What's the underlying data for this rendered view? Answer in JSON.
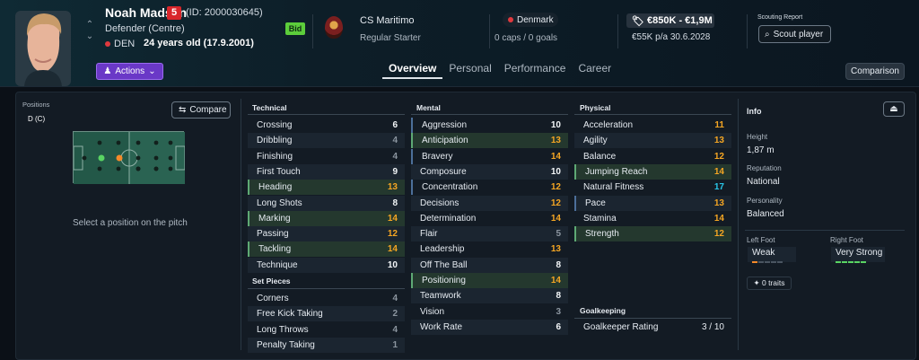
{
  "player": {
    "name": "Noah Madsen",
    "number": "5",
    "id": "(ID: 2000030645)",
    "position": "Defender (Centre)",
    "nationality_code": "DEN",
    "age": "24 years old (17.9.2001)",
    "bid_label": "Bid"
  },
  "club": {
    "name": "CS Maritimo",
    "role": "Regular Starter"
  },
  "country": {
    "name": "Denmark",
    "caps": "0 caps / 0 goals"
  },
  "contract": {
    "value": "€850K - €1,9M",
    "wage": "€55K p/a 30.6.2028"
  },
  "scouting": {
    "label": "Scouting Report",
    "button": "Scout player"
  },
  "actions_label": "Actions",
  "tabs": [
    "Overview",
    "Personal",
    "Performance",
    "Career"
  ],
  "comparison_label": "Comparison",
  "positions": {
    "label": "Positions",
    "value": "D (C)",
    "compare_label": "Compare",
    "hint": "Select a position on the pitch"
  },
  "technical": {
    "title": "Technical",
    "attrs": [
      {
        "name": "Crossing",
        "value": "6",
        "color": "white"
      },
      {
        "name": "Dribbling",
        "value": "4",
        "color": "grey"
      },
      {
        "name": "Finishing",
        "value": "4",
        "color": "grey"
      },
      {
        "name": "First Touch",
        "value": "9",
        "color": "white"
      },
      {
        "name": "Heading",
        "value": "13",
        "color": "orange",
        "hl": true
      },
      {
        "name": "Long Shots",
        "value": "8",
        "color": "white"
      },
      {
        "name": "Marking",
        "value": "14",
        "color": "orange",
        "hl": true
      },
      {
        "name": "Passing",
        "value": "12",
        "color": "orange"
      },
      {
        "name": "Tackling",
        "value": "14",
        "color": "orange",
        "hl": true
      },
      {
        "name": "Technique",
        "value": "10",
        "color": "white"
      }
    ]
  },
  "set_pieces": {
    "title": "Set Pieces",
    "attrs": [
      {
        "name": "Corners",
        "value": "4",
        "color": "grey"
      },
      {
        "name": "Free Kick Taking",
        "value": "2",
        "color": "grey"
      },
      {
        "name": "Long Throws",
        "value": "4",
        "color": "grey"
      },
      {
        "name": "Penalty Taking",
        "value": "1",
        "color": "grey"
      }
    ]
  },
  "mental": {
    "title": "Mental",
    "attrs": [
      {
        "name": "Aggression",
        "value": "10",
        "color": "white",
        "bl": true
      },
      {
        "name": "Anticipation",
        "value": "13",
        "color": "orange",
        "hl": true
      },
      {
        "name": "Bravery",
        "value": "14",
        "color": "orange",
        "bl": true
      },
      {
        "name": "Composure",
        "value": "10",
        "color": "white"
      },
      {
        "name": "Concentration",
        "value": "12",
        "color": "orange",
        "bl": true
      },
      {
        "name": "Decisions",
        "value": "12",
        "color": "orange"
      },
      {
        "name": "Determination",
        "value": "14",
        "color": "orange"
      },
      {
        "name": "Flair",
        "value": "5",
        "color": "grey"
      },
      {
        "name": "Leadership",
        "value": "13",
        "color": "orange"
      },
      {
        "name": "Off The Ball",
        "value": "8",
        "color": "white"
      },
      {
        "name": "Positioning",
        "value": "14",
        "color": "orange",
        "hl": true
      },
      {
        "name": "Teamwork",
        "value": "8",
        "color": "white"
      },
      {
        "name": "Vision",
        "value": "3",
        "color": "grey"
      },
      {
        "name": "Work Rate",
        "value": "6",
        "color": "white"
      }
    ]
  },
  "physical": {
    "title": "Physical",
    "attrs": [
      {
        "name": "Acceleration",
        "value": "11",
        "color": "orange"
      },
      {
        "name": "Agility",
        "value": "13",
        "color": "orange"
      },
      {
        "name": "Balance",
        "value": "12",
        "color": "orange"
      },
      {
        "name": "Jumping Reach",
        "value": "14",
        "color": "orange",
        "hl": true
      },
      {
        "name": "Natural Fitness",
        "value": "17",
        "color": "cyan"
      },
      {
        "name": "Pace",
        "value": "13",
        "color": "orange",
        "bl": true
      },
      {
        "name": "Stamina",
        "value": "14",
        "color": "orange"
      },
      {
        "name": "Strength",
        "value": "12",
        "color": "orange",
        "hl": true
      }
    ]
  },
  "goalkeeping": {
    "title": "Goalkeeping",
    "rating_label": "Goalkeeper Rating",
    "rating_value": "3 / 10"
  },
  "info": {
    "title": "Info",
    "height_label": "Height",
    "height": "1,87 m",
    "reputation_label": "Reputation",
    "reputation": "National",
    "personality_label": "Personality",
    "personality": "Balanced",
    "left_foot_label": "Left Foot",
    "left_foot": "Weak",
    "left_foot_level": 0.2,
    "right_foot_label": "Right Foot",
    "right_foot": "Very Strong",
    "right_foot_level": 1.0,
    "traits": "0 traits"
  },
  "colors": {
    "accent": "#6a38c7",
    "orange": "#f5a623",
    "cyan": "#29c6e8",
    "green": "#5ccd3b",
    "red": "#d9262b"
  }
}
